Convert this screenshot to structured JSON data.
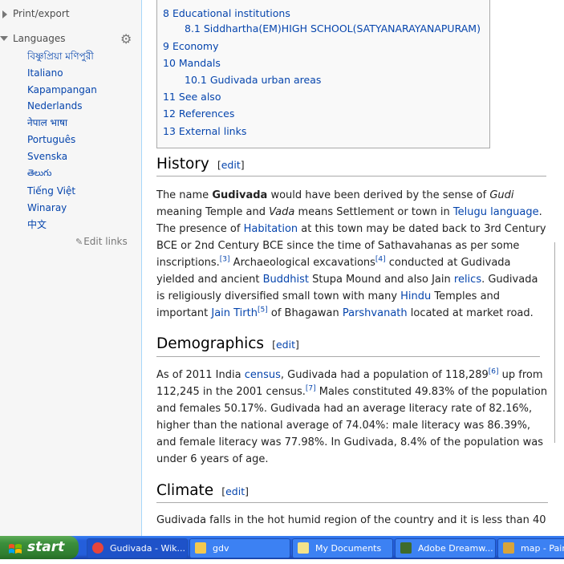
{
  "sidebar": {
    "print_export": "Print/export",
    "languages": "Languages",
    "lang_items": [
      "বিষ্ণুপ্রিয়া মণিপুরী",
      "Italiano",
      "Kapampangan",
      "Nederlands",
      "नेपाल भाषा",
      "Português",
      "Svenska",
      "తెలుగు",
      "Tiếng Việt",
      "Winaray",
      "中文"
    ],
    "edit_links": "Edit links"
  },
  "toc": {
    "items": [
      {
        "num": "8",
        "text": "Educational institutions"
      },
      {
        "num": "8.1",
        "text": "Siddhartha(EM)HIGH SCHOOL(SATYANARAYANAPURAM)"
      },
      {
        "num": "9",
        "text": "Economy"
      },
      {
        "num": "10",
        "text": "Mandals"
      },
      {
        "num": "10.1",
        "text": "Gudivada urban areas"
      },
      {
        "num": "11",
        "text": "See also"
      },
      {
        "num": "12",
        "text": "References"
      },
      {
        "num": "13",
        "text": "External links"
      }
    ]
  },
  "sections": {
    "history": {
      "title": "History",
      "edit": "edit"
    },
    "demographics": {
      "title": "Demographics",
      "edit": "edit"
    },
    "climate": {
      "title": "Climate",
      "edit": "edit"
    }
  },
  "paragraphs": {
    "history": {
      "t1": "The name ",
      "b1": "Gudivada",
      "t2": " would have been derived by the sense of ",
      "i1": "Gudi",
      "t3": " meaning Temple and ",
      "i2": "Vada",
      "t4": " means Settlement or town in ",
      "l1": "Telugu language",
      "t5": ". The presence of ",
      "l2": "Habitation",
      "t6": " at this town may be dated back to 3rd Century BCE or 2nd Century BCE since the time of Sathavahanas as per some inscriptions.",
      "s1": "[3]",
      "t7": " Archaeological excavations",
      "s2": "[4]",
      "t8": " conducted at Gudivada yielded and ancient ",
      "l3": "Buddhist",
      "t9": " Stupa Mound and also Jain ",
      "l4": "relics",
      "t10": ". Gudivada is religiously diversified small town with many ",
      "l5": "Hindu",
      "t11": " Temples and important ",
      "l6": "Jain Tirth",
      "s3": "[5]",
      "t12": " of Bhagawan ",
      "l7": "Parshvanath",
      "t13": " located at market road."
    },
    "demographics": {
      "t1": "As of 2011 India ",
      "l1": "census",
      "t2": ", Gudivada had a population of 118,289",
      "s1": "[6]",
      "t3": " up from 112,245 in the 2001 census.",
      "s2": "[7]",
      "t4": " Males constituted 49.83% of the population and females 50.17%. Gudivada had an average literacy rate of 82.16%, higher than the national average of 74.04%: male literacy was 86.39%, and female literacy was 77.98%. In Gudivada, 8.4% of the population was under 6 years of age."
    },
    "climate": {
      "t1": "Gudivada falls in the hot humid region of the country and it is less than 40"
    }
  },
  "taskbar": {
    "start": "start",
    "tasks": [
      {
        "label": "Gudivada - Wik...",
        "icon": "chrome-icon",
        "color": "#e8453c"
      },
      {
        "label": "gdv",
        "icon": "folder-icon",
        "color": "#f3c94f"
      },
      {
        "label": "My Documents",
        "icon": "documents-icon",
        "color": "#f3e28a"
      },
      {
        "label": "Adobe Dreamw...",
        "icon": "dreamweaver-icon",
        "color": "#3f6b2c"
      },
      {
        "label": "map - Paint",
        "icon": "paint-icon",
        "color": "#d9a43a"
      }
    ]
  }
}
